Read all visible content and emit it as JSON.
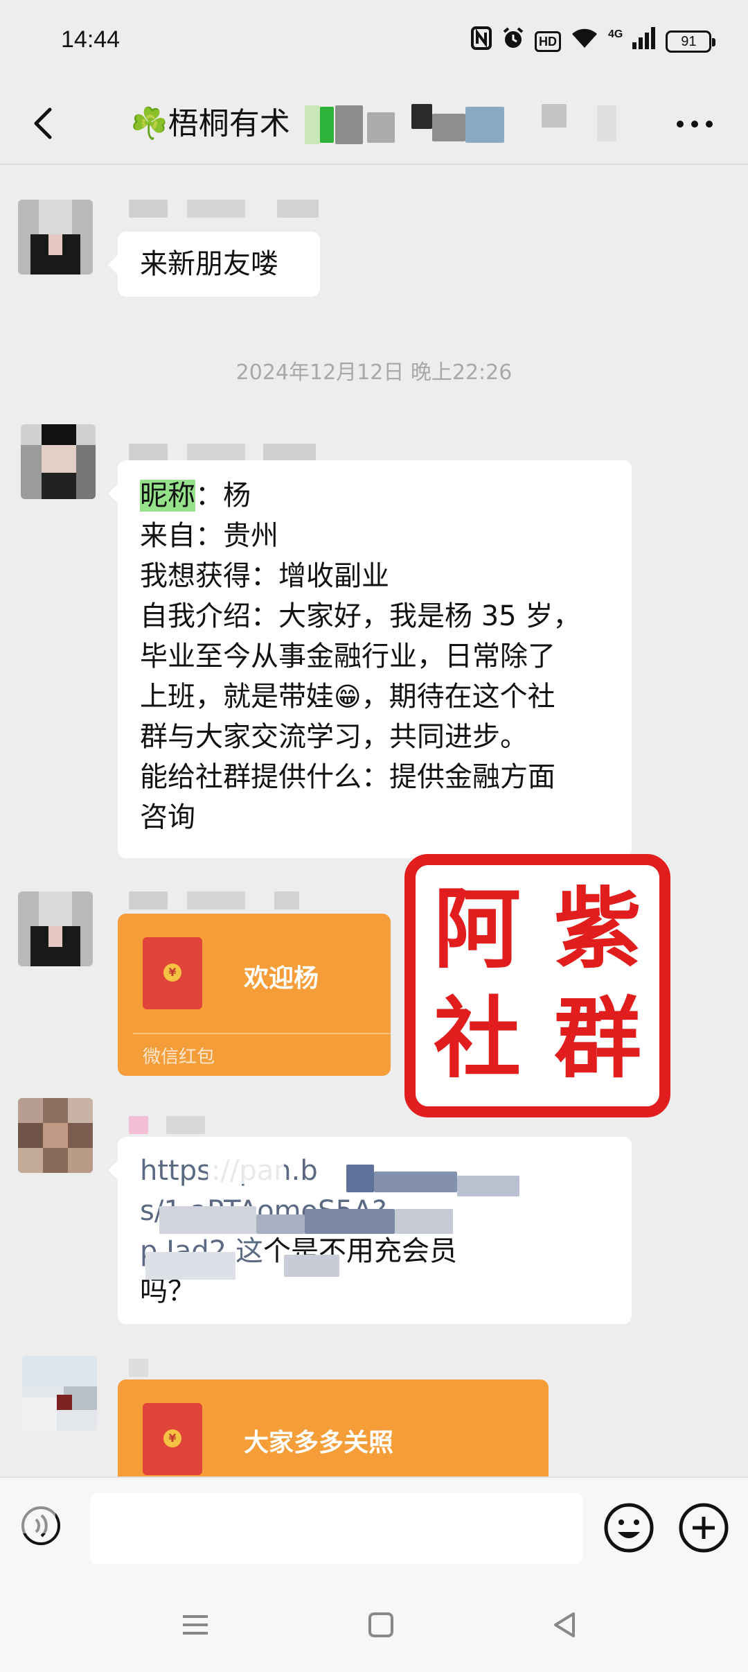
{
  "status_bar": {
    "time": "14:44",
    "nfc_icon": "nfc-icon",
    "alarm_icon": "alarm-icon",
    "hd_label": "HD",
    "network_label": "4G",
    "battery": "91"
  },
  "header": {
    "title": "☘️梧桐有术",
    "back_icon": "chevron-left-icon",
    "more_icon": "more-icon"
  },
  "messages": {
    "m1": {
      "text": "来新朋友喽"
    },
    "timestamp": "2024年12月12日 晚上22:26",
    "m2": {
      "highlight": "昵称",
      "line1_rest": "：杨",
      "line2": "来自：贵州",
      "line3": "我想获得：增收副业",
      "line4": "自我介绍：大家好，我是杨 35 岁，",
      "line5": "毕业至今从事金融行业，日常除了",
      "line6_a": "上班，就是带娃",
      "line6_emoji": "😁",
      "line6_b": "，期待在这个社",
      "line7": "群与大家交流学习，共同进步。",
      "line8": "能给社群提供什么：提供金融方面",
      "line9": "咨询"
    },
    "m3": {
      "packet_title": "欢迎杨",
      "packet_footer": "微信红包"
    },
    "m4": {
      "line1": "https://pan.b",
      "line2": "s/1                aPTAomoS5A?",
      "line3_a": "p        Jad2 这",
      "line3_b": "个是不用充会员",
      "line4": "吗？"
    },
    "m5": {
      "packet_title": "大家多多关照"
    }
  },
  "stamp": {
    "chars": [
      "阿",
      "紫",
      "社",
      "群"
    ]
  },
  "input_bar": {
    "voice_icon": "voice-icon",
    "placeholder": "",
    "emoji_icon": "emoji-icon",
    "plus_icon": "plus-icon"
  },
  "nav_bar": {
    "menu_icon": "menu-icon",
    "home_icon": "home-icon",
    "back_icon": "back-triangle-icon"
  },
  "colors": {
    "background": "#ededed",
    "bubble": "#ffffff",
    "red_packet": "#f59d38",
    "highlight": "#95e28a",
    "stamp_red": "#e21d1d"
  }
}
